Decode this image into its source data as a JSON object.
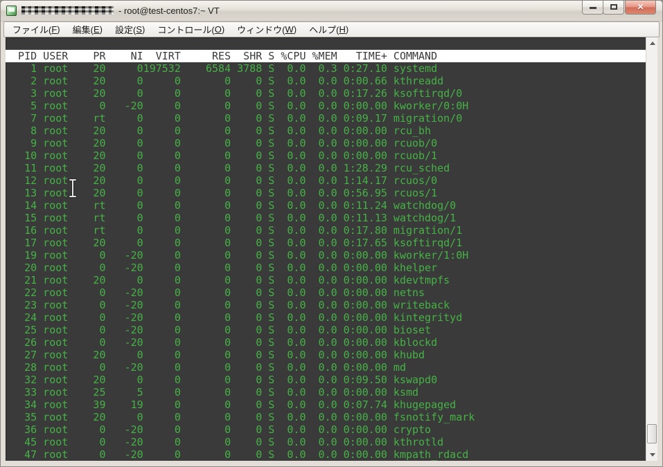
{
  "window": {
    "title": "- root@test-centos7:~ VT",
    "title_note": "redacted-host-prefix",
    "close_glyph": "✕"
  },
  "menubar": {
    "items": [
      {
        "id": "file",
        "text": "ファイル",
        "key": "F"
      },
      {
        "id": "edit",
        "text": "編集",
        "key": "E"
      },
      {
        "id": "setup",
        "text": "設定",
        "key": "S"
      },
      {
        "id": "control",
        "text": "コントロール",
        "key": "O"
      },
      {
        "id": "window",
        "text": "ウィンドウ",
        "key": "W"
      },
      {
        "id": "help",
        "text": "ヘルプ",
        "key": "H"
      }
    ]
  },
  "terminal": {
    "colors": {
      "background": "#3a3a3a",
      "foreground_green": "#46b246",
      "header_background": "#ffffff",
      "header_text": "#3a3a3a"
    },
    "columns": [
      "PID",
      "USER",
      "PR",
      "NI",
      "VIRT",
      "RES",
      "SHR",
      "S",
      "%CPU",
      "%MEM",
      "TIME+",
      "COMMAND"
    ],
    "rows": [
      [
        "1",
        "root",
        "20",
        "0",
        "197532",
        "6584",
        "3788",
        "S",
        "0.0",
        "0.3",
        "0:27.10",
        "systemd"
      ],
      [
        "2",
        "root",
        "20",
        "0",
        "0",
        "0",
        "0",
        "S",
        "0.0",
        "0.0",
        "0:00.66",
        "kthreadd"
      ],
      [
        "3",
        "root",
        "20",
        "0",
        "0",
        "0",
        "0",
        "S",
        "0.0",
        "0.0",
        "0:17.26",
        "ksoftirqd/0"
      ],
      [
        "5",
        "root",
        "0",
        "-20",
        "0",
        "0",
        "0",
        "S",
        "0.0",
        "0.0",
        "0:00.00",
        "kworker/0:0H"
      ],
      [
        "7",
        "root",
        "rt",
        "0",
        "0",
        "0",
        "0",
        "S",
        "0.0",
        "0.0",
        "0:09.17",
        "migration/0"
      ],
      [
        "8",
        "root",
        "20",
        "0",
        "0",
        "0",
        "0",
        "S",
        "0.0",
        "0.0",
        "0:00.00",
        "rcu_bh"
      ],
      [
        "9",
        "root",
        "20",
        "0",
        "0",
        "0",
        "0",
        "S",
        "0.0",
        "0.0",
        "0:00.00",
        "rcuob/0"
      ],
      [
        "10",
        "root",
        "20",
        "0",
        "0",
        "0",
        "0",
        "S",
        "0.0",
        "0.0",
        "0:00.00",
        "rcuob/1"
      ],
      [
        "11",
        "root",
        "20",
        "0",
        "0",
        "0",
        "0",
        "S",
        "0.0",
        "0.0",
        "1:28.29",
        "rcu_sched"
      ],
      [
        "12",
        "root",
        "20",
        "0",
        "0",
        "0",
        "0",
        "S",
        "0.0",
        "0.0",
        "1:14.17",
        "rcuos/0"
      ],
      [
        "13",
        "root",
        "20",
        "0",
        "0",
        "0",
        "0",
        "S",
        "0.0",
        "0.0",
        "0:56.95",
        "rcuos/1"
      ],
      [
        "14",
        "root",
        "rt",
        "0",
        "0",
        "0",
        "0",
        "S",
        "0.0",
        "0.0",
        "0:11.24",
        "watchdog/0"
      ],
      [
        "15",
        "root",
        "rt",
        "0",
        "0",
        "0",
        "0",
        "S",
        "0.0",
        "0.0",
        "0:11.13",
        "watchdog/1"
      ],
      [
        "16",
        "root",
        "rt",
        "0",
        "0",
        "0",
        "0",
        "S",
        "0.0",
        "0.0",
        "0:17.80",
        "migration/1"
      ],
      [
        "17",
        "root",
        "20",
        "0",
        "0",
        "0",
        "0",
        "S",
        "0.0",
        "0.0",
        "0:17.65",
        "ksoftirqd/1"
      ],
      [
        "19",
        "root",
        "0",
        "-20",
        "0",
        "0",
        "0",
        "S",
        "0.0",
        "0.0",
        "0:00.00",
        "kworker/1:0H"
      ],
      [
        "20",
        "root",
        "0",
        "-20",
        "0",
        "0",
        "0",
        "S",
        "0.0",
        "0.0",
        "0:00.00",
        "khelper"
      ],
      [
        "21",
        "root",
        "20",
        "0",
        "0",
        "0",
        "0",
        "S",
        "0.0",
        "0.0",
        "0:00.00",
        "kdevtmpfs"
      ],
      [
        "22",
        "root",
        "0",
        "-20",
        "0",
        "0",
        "0",
        "S",
        "0.0",
        "0.0",
        "0:00.00",
        "netns"
      ],
      [
        "23",
        "root",
        "0",
        "-20",
        "0",
        "0",
        "0",
        "S",
        "0.0",
        "0.0",
        "0:00.00",
        "writeback"
      ],
      [
        "24",
        "root",
        "0",
        "-20",
        "0",
        "0",
        "0",
        "S",
        "0.0",
        "0.0",
        "0:00.00",
        "kintegrityd"
      ],
      [
        "25",
        "root",
        "0",
        "-20",
        "0",
        "0",
        "0",
        "S",
        "0.0",
        "0.0",
        "0:00.00",
        "bioset"
      ],
      [
        "26",
        "root",
        "0",
        "-20",
        "0",
        "0",
        "0",
        "S",
        "0.0",
        "0.0",
        "0:00.00",
        "kblockd"
      ],
      [
        "27",
        "root",
        "20",
        "0",
        "0",
        "0",
        "0",
        "S",
        "0.0",
        "0.0",
        "0:00.00",
        "khubd"
      ],
      [
        "28",
        "root",
        "0",
        "-20",
        "0",
        "0",
        "0",
        "S",
        "0.0",
        "0.0",
        "0:00.00",
        "md"
      ],
      [
        "32",
        "root",
        "20",
        "0",
        "0",
        "0",
        "0",
        "S",
        "0.0",
        "0.0",
        "0:09.50",
        "kswapd0"
      ],
      [
        "33",
        "root",
        "25",
        "5",
        "0",
        "0",
        "0",
        "S",
        "0.0",
        "0.0",
        "0:00.00",
        "ksmd"
      ],
      [
        "34",
        "root",
        "39",
        "19",
        "0",
        "0",
        "0",
        "S",
        "0.0",
        "0.0",
        "0:07.74",
        "khugepaged"
      ],
      [
        "35",
        "root",
        "20",
        "0",
        "0",
        "0",
        "0",
        "S",
        "0.0",
        "0.0",
        "0:00.00",
        "fsnotify_mark"
      ],
      [
        "36",
        "root",
        "0",
        "-20",
        "0",
        "0",
        "0",
        "S",
        "0.0",
        "0.0",
        "0:00.00",
        "crypto"
      ],
      [
        "45",
        "root",
        "0",
        "-20",
        "0",
        "0",
        "0",
        "S",
        "0.0",
        "0.0",
        "0:00.00",
        "kthrotld"
      ],
      [
        "47",
        "root",
        "0",
        "-20",
        "0",
        "0",
        "0",
        "S",
        "0.0",
        "0.0",
        "0:00.00",
        "kmpath_rdacd"
      ]
    ]
  }
}
